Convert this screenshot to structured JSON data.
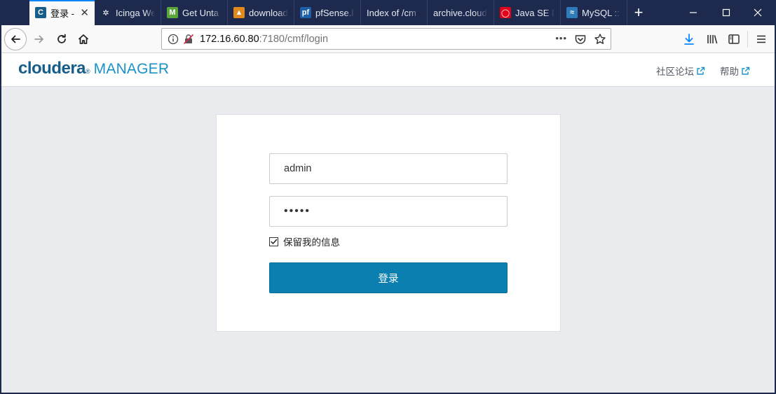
{
  "tabs": [
    {
      "title": "登录 -",
      "favicon": "cloudera-c-icon",
      "favicon_glyph": "C",
      "favicon_color": "#165d89",
      "active": true,
      "width": 93
    },
    {
      "title": "Icinga We",
      "favicon": "icinga-icon",
      "favicon_glyph": "✲",
      "favicon_color": "#1d2a4e",
      "active": false,
      "width": 95
    },
    {
      "title": "Get Unta",
      "favicon": "untangle-icon",
      "favicon_glyph": "M",
      "favicon_color": "#5aa63c",
      "active": false,
      "width": 95
    },
    {
      "title": "download",
      "favicon": "download-cone-icon",
      "favicon_glyph": "▲",
      "favicon_color": "#e08a1e",
      "active": false,
      "width": 95
    },
    {
      "title": "pfSense.l",
      "favicon": "pfsense-icon",
      "favicon_glyph": "pf",
      "favicon_color": "#1d5fa8",
      "active": false,
      "width": 95
    },
    {
      "title": "Index of /cm",
      "favicon": "",
      "favicon_glyph": "",
      "favicon_color": "",
      "active": false,
      "width": 95
    },
    {
      "title": "archive.cloud",
      "favicon": "",
      "favicon_glyph": "",
      "favicon_color": "",
      "active": false,
      "width": 95
    },
    {
      "title": "Java SE D",
      "favicon": "oracle-icon",
      "favicon_glyph": "◯",
      "favicon_color": "#e2001a",
      "active": false,
      "width": 95
    },
    {
      "title": "MySQL ::",
      "favicon": "mysql-icon",
      "favicon_glyph": "≈",
      "favicon_color": "#2f7ab8",
      "active": false,
      "width": 95
    }
  ],
  "url": {
    "host": "172.16.60.80",
    "path": ":7180/cmf/login",
    "more": "•••"
  },
  "header": {
    "logo_word": "cloudera",
    "logo_reg": "®",
    "logo_product": "MANAGER",
    "community_link": "社区论坛",
    "help_link": "帮助"
  },
  "login": {
    "username": "admin",
    "password_mask": "•••••",
    "remember_label": "保留我的信息",
    "remember_checked": true,
    "submit_label": "登录"
  },
  "colors": {
    "accent": "#0b80b0",
    "tab_bar": "#1d2a4e",
    "page_bg": "#e9ebee",
    "logo_dark": "#165d89",
    "logo_light": "#1a91c8"
  }
}
